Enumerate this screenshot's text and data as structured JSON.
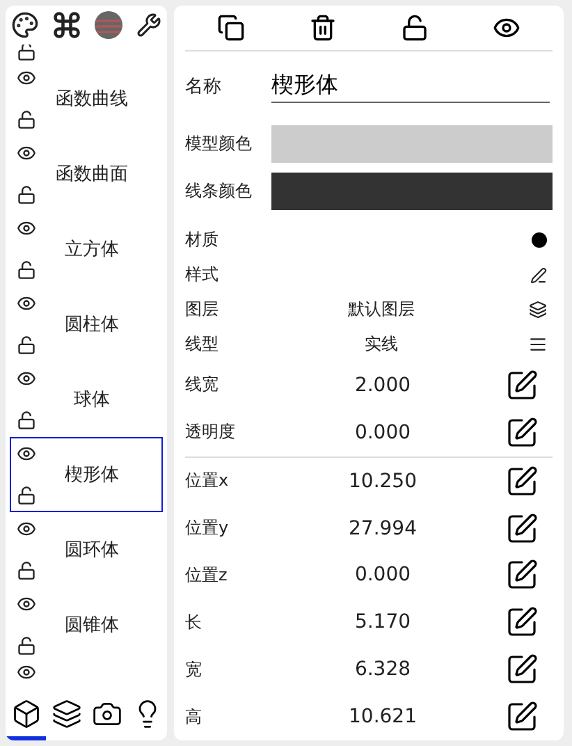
{
  "object_list": [
    {
      "name": "函数曲线",
      "selected": false,
      "visible": true,
      "locked": false
    },
    {
      "name": "函数曲面",
      "selected": false,
      "visible": true,
      "locked": false
    },
    {
      "name": "立方体",
      "selected": false,
      "visible": true,
      "locked": false
    },
    {
      "name": "圆柱体",
      "selected": false,
      "visible": true,
      "locked": false
    },
    {
      "name": "球体",
      "selected": false,
      "visible": true,
      "locked": false
    },
    {
      "name": "楔形体",
      "selected": true,
      "visible": true,
      "locked": false
    },
    {
      "name": "圆环体",
      "selected": false,
      "visible": true,
      "locked": false
    },
    {
      "name": "圆锥体",
      "selected": false,
      "visible": true,
      "locked": false
    }
  ],
  "bottom_tabs": [
    {
      "kind": "model",
      "selected": true
    },
    {
      "kind": "layers",
      "selected": false
    },
    {
      "kind": "camera",
      "selected": false
    },
    {
      "kind": "light",
      "selected": false
    }
  ],
  "properties_panel": {
    "name": {
      "label": "名称",
      "value": "楔形体"
    },
    "model_color": {
      "label": "模型颜色",
      "color": "#cccccc"
    },
    "line_color": {
      "label": "线条颜色",
      "color": "#333333"
    },
    "rows": [
      {
        "kind": "material",
        "label": "材质"
      },
      {
        "kind": "style",
        "label": "样式"
      },
      {
        "kind": "layer",
        "label": "图层",
        "value": "默认图层"
      },
      {
        "kind": "linetype",
        "label": "线型",
        "value": "实线"
      },
      {
        "kind": "number",
        "label": "线宽",
        "value": "2.000"
      },
      {
        "kind": "number",
        "label": "透明度",
        "value": "0.000",
        "divider_after": true
      },
      {
        "kind": "number",
        "label": "位置x",
        "value": "10.250"
      },
      {
        "kind": "number",
        "label": "位置y",
        "value": "27.994"
      },
      {
        "kind": "number",
        "label": "位置z",
        "value": "0.000"
      },
      {
        "kind": "number",
        "label": "长",
        "value": "5.170"
      },
      {
        "kind": "number",
        "label": "宽",
        "value": "6.328"
      },
      {
        "kind": "number",
        "label": "高",
        "value": "10.621"
      }
    ]
  }
}
